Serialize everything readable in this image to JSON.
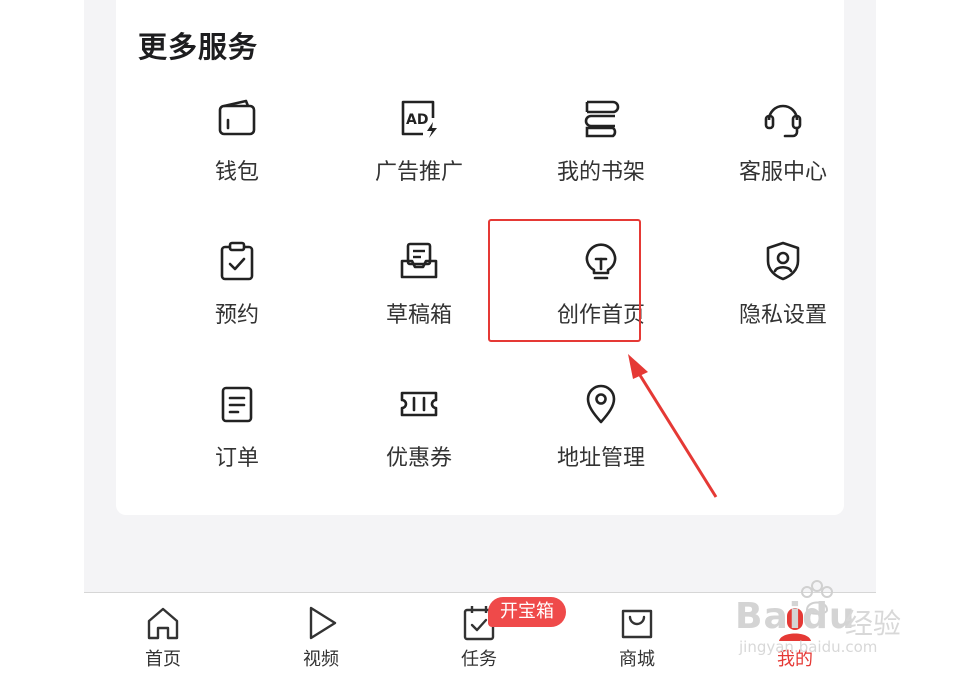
{
  "section": {
    "title": "更多服务"
  },
  "services": [
    {
      "label": "钱包",
      "icon": "wallet-icon"
    },
    {
      "label": "广告推广",
      "icon": "ad-icon"
    },
    {
      "label": "我的书架",
      "icon": "bookshelf-icon"
    },
    {
      "label": "客服中心",
      "icon": "headset-icon"
    },
    {
      "label": "预约",
      "icon": "clipboard-check-icon"
    },
    {
      "label": "草稿箱",
      "icon": "draft-box-icon"
    },
    {
      "label": "创作首页",
      "icon": "lightbulb-icon"
    },
    {
      "label": "隐私设置",
      "icon": "shield-user-icon"
    },
    {
      "label": "订单",
      "icon": "order-icon"
    },
    {
      "label": "优惠券",
      "icon": "coupon-icon"
    },
    {
      "label": "地址管理",
      "icon": "location-icon"
    }
  ],
  "tabbar": {
    "items": [
      {
        "label": "首页",
        "icon": "home-icon"
      },
      {
        "label": "视频",
        "icon": "play-icon"
      },
      {
        "label": "任务",
        "icon": "task-icon"
      },
      {
        "label": "商城",
        "icon": "shopping-bag-icon"
      },
      {
        "label": "我的",
        "icon": "profile-icon"
      }
    ],
    "badge": "开宝箱",
    "active_color": "#e53935"
  },
  "annotation": {
    "highlight_color": "#e53935"
  },
  "watermark": {
    "brand": "Baidu",
    "cn": "经验",
    "url": "jingyan.baidu.com"
  }
}
